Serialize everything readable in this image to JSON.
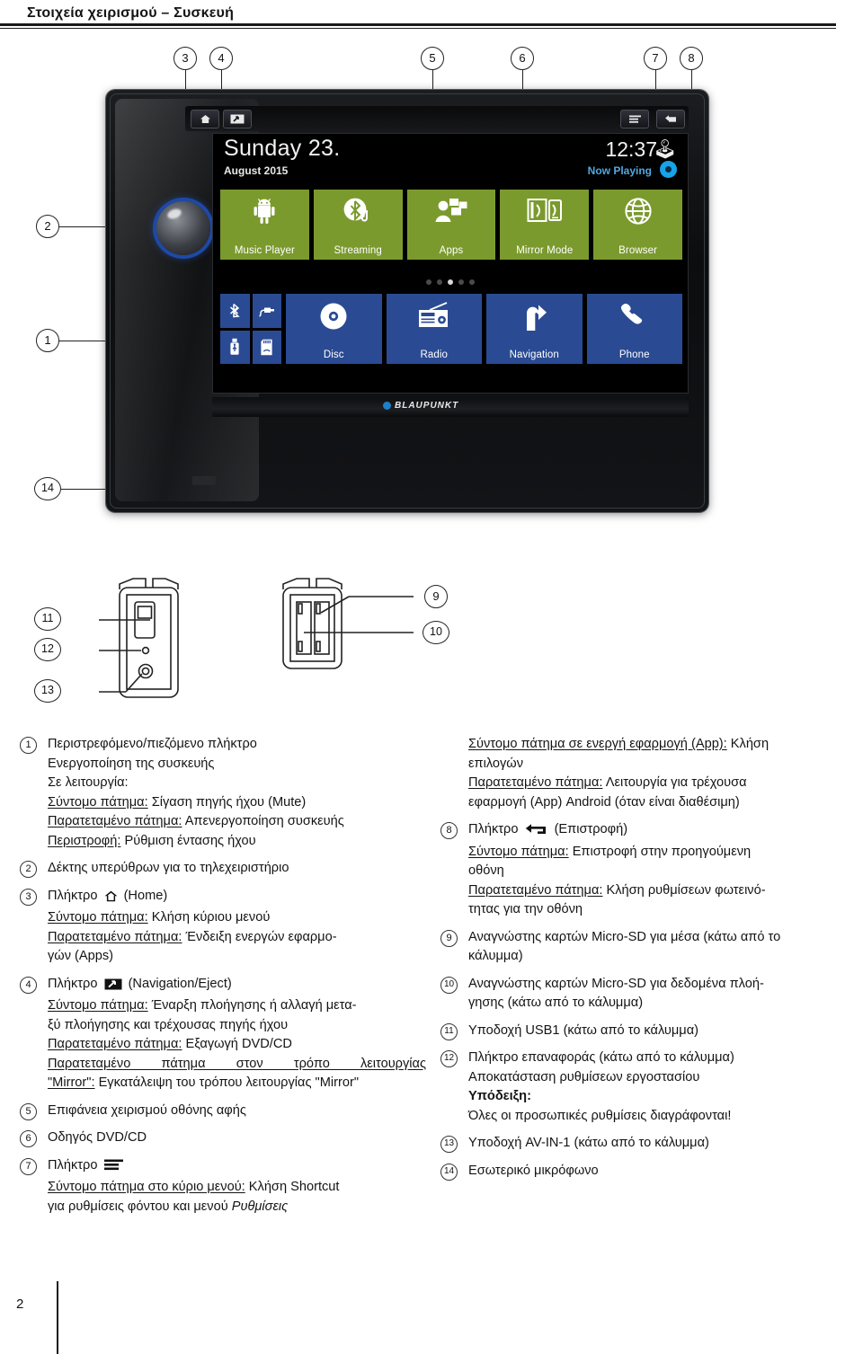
{
  "header": {
    "title": "Στοιχεία χειρισμού – Συσκευή"
  },
  "page": {
    "number": "2"
  },
  "figure": {
    "callouts": [
      "1",
      "2",
      "3",
      "4",
      "5",
      "6",
      "7",
      "8",
      "9",
      "10",
      "11",
      "12",
      "13",
      "14"
    ],
    "device": {
      "brand": "BLAUPUNKT",
      "bezel_buttons": [
        "home-icon",
        "navigation-eject-icon",
        "menu-icon",
        "back-icon"
      ],
      "screen": {
        "date": "Sunday 23.",
        "month_year": "August 2015",
        "time": "12:37",
        "bluetooth_icon": "bluetooth-icon",
        "now_playing": "Now Playing",
        "page_dots": {
          "count": 5,
          "active_index": 2
        },
        "tiles_row1": [
          {
            "label": "Music Player",
            "icon": "android-icon",
            "color": "#7b9a2e"
          },
          {
            "label": "Streaming",
            "icon": "bluetooth-audio-icon",
            "color": "#7b9a2e"
          },
          {
            "label": "Apps",
            "icon": "apps-person-icon",
            "color": "#7b9a2e"
          },
          {
            "label": "Mirror Mode",
            "icon": "mirror-mode-icon",
            "color": "#7b9a2e"
          },
          {
            "label": "Browser",
            "icon": "globe-icon",
            "color": "#7b9a2e"
          }
        ],
        "tiles_row2_mini": [
          {
            "label": "",
            "icon": "bluetooth-icon",
            "color": "#2a4b93"
          },
          {
            "label": "",
            "icon": "aux-plug-icon",
            "color": "#2a4b93"
          },
          {
            "label": "",
            "icon": "usb-icon",
            "color": "#2a4b93"
          },
          {
            "label": "",
            "icon": "sd-card-icon",
            "color": "#2a4b93"
          }
        ],
        "tiles_row2": [
          {
            "label": "Disc",
            "icon": "disc-icon",
            "color": "#2a4b93"
          },
          {
            "label": "Radio",
            "icon": "radio-icon",
            "color": "#2a4b93"
          },
          {
            "label": "Navigation",
            "icon": "navigation-arrow-icon",
            "color": "#2a4b93"
          },
          {
            "label": "Phone",
            "icon": "phone-handset-icon",
            "color": "#2a4b93"
          }
        ]
      }
    }
  },
  "legend": {
    "left": [
      {
        "num": "1",
        "lines": [
          {
            "text": "Περιστρεφόμενο/πιεζόμενο πλήκτρο"
          },
          {
            "text": "Ενεργοποίηση της συσκευής"
          },
          {
            "text": "Σε λειτουργία:"
          },
          {
            "label": "Σύντομο πάτημα:",
            "text": " Σίγαση πηγής ήχου (Mute)"
          },
          {
            "label": "Παρατεταμένο πάτημα:",
            "text": " Απενεργοποίηση συσκευής"
          },
          {
            "label": "Περιστροφή:",
            "text": " Ρύθμιση έντασης ήχου"
          }
        ]
      },
      {
        "num": "2",
        "lines": [
          {
            "text": "Δέκτης υπερύθρων για το τηλεχειριστήριο"
          }
        ]
      },
      {
        "num": "3",
        "lines": [
          {
            "text": "Πλήκτρο",
            "icon": "home-icon",
            "after": "(Home)"
          },
          {
            "label": "Σύντομο πάτημα:",
            "text": " Κλήση κύριου μενού"
          },
          {
            "label": "Παρατεταμένο πάτημα:",
            "text": " Ένδειξη ενεργών εφαρμο-"
          },
          {
            "text": "γών (Apps)"
          }
        ]
      },
      {
        "num": "4",
        "lines": [
          {
            "text": "Πλήκτρο",
            "icon": "navigation-eject-icon",
            "after": "(Navigation/Eject)"
          },
          {
            "label": "Σύντομο πάτημα:",
            "text": " Έναρξη πλοήγησης ή αλλαγή μετα-"
          },
          {
            "text": "ξύ πλοήγησης και τρέχουσας πηγής ήχου"
          },
          {
            "label": "Παρατεταμένο πάτημα:",
            "text": " Εξαγωγή DVD/CD"
          },
          {
            "label": "Παρατεταμένο πάτημα στον τρόπο λειτουργίας",
            "text": ""
          },
          {
            "label": "\"Mirror\":",
            "text": " Εγκατάλειψη του τρόπου λειτουργίας \"Mirror\""
          }
        ]
      },
      {
        "num": "5",
        "lines": [
          {
            "text": "Επιφάνεια χειρισμού οθόνης αφής"
          }
        ]
      },
      {
        "num": "6",
        "lines": [
          {
            "text": "Οδηγός DVD/CD"
          }
        ]
      },
      {
        "num": "7",
        "lines": [
          {
            "text": "Πλήκτρο",
            "icon": "menu-icon",
            "after": ""
          },
          {
            "label": "Σύντομο πάτημα στο κύριο μενού:",
            "text": " Κλήση Shortcut"
          },
          {
            "text": "για ρυθμίσεις φόντου και μενού ",
            "italic": "Ρυθμίσεις"
          }
        ]
      }
    ],
    "right": [
      {
        "num": "",
        "lines": [
          {
            "label": "Σύντομο πάτημα σε ενεργή εφαρμογή (App):",
            "text": " Κλήση"
          },
          {
            "text": "επιλογών"
          },
          {
            "label": "Παρατεταμένο πάτημα:",
            "text": " Λειτουργία για τρέχουσα"
          },
          {
            "text": "εφαρμογή (App) Android (όταν είναι διαθέσιμη)"
          }
        ]
      },
      {
        "num": "8",
        "lines": [
          {
            "text": "Πλήκτρο",
            "icon": "back-icon",
            "after": "(Επιστροφή)"
          },
          {
            "label": "Σύντομο πάτημα:",
            "text": " Επιστροφή στην προηγούμενη"
          },
          {
            "text": "οθόνη"
          },
          {
            "label": "Παρατεταμένο πάτημα:",
            "text": " Κλήση ρυθμίσεων φωτεινό-"
          },
          {
            "text": "τητας για την οθόνη"
          }
        ]
      },
      {
        "num": "9",
        "lines": [
          {
            "text": "Αναγνώστης καρτών Micro-SD για μέσα (κάτω από το"
          },
          {
            "text": "κάλυμμα)"
          }
        ]
      },
      {
        "num": "10",
        "lines": [
          {
            "text": "Αναγνώστης καρτών Micro-SD για δεδομένα πλοή-"
          },
          {
            "text": "γησης (κάτω από το κάλυμμα)"
          }
        ]
      },
      {
        "num": "11",
        "lines": [
          {
            "text": "Υποδοχή USB1 (κάτω από το κάλυμμα)"
          }
        ]
      },
      {
        "num": "12",
        "lines": [
          {
            "text": "Πλήκτρο επαναφοράς (κάτω από το κάλυμμα)"
          },
          {
            "text": "Αποκατάσταση ρυθμίσεων εργοστασίου"
          },
          {
            "bold": "Υπόδειξη:"
          },
          {
            "text": "Όλες οι προσωπικές ρυθμίσεις διαγράφονται!"
          }
        ]
      },
      {
        "num": "13",
        "lines": [
          {
            "text": "Υποδοχή AV-IN-1 (κάτω από το κάλυμμα)"
          }
        ]
      },
      {
        "num": "14",
        "lines": [
          {
            "text": "Εσωτερικό μικρόφωνο"
          }
        ]
      }
    ]
  }
}
